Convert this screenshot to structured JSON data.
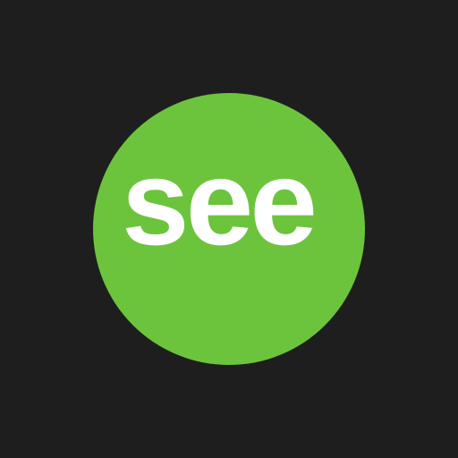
{
  "logo": {
    "text": "see",
    "circle_color": "#6cc43c",
    "text_color": "#ffffff",
    "background_color": "#1e1e1e"
  }
}
